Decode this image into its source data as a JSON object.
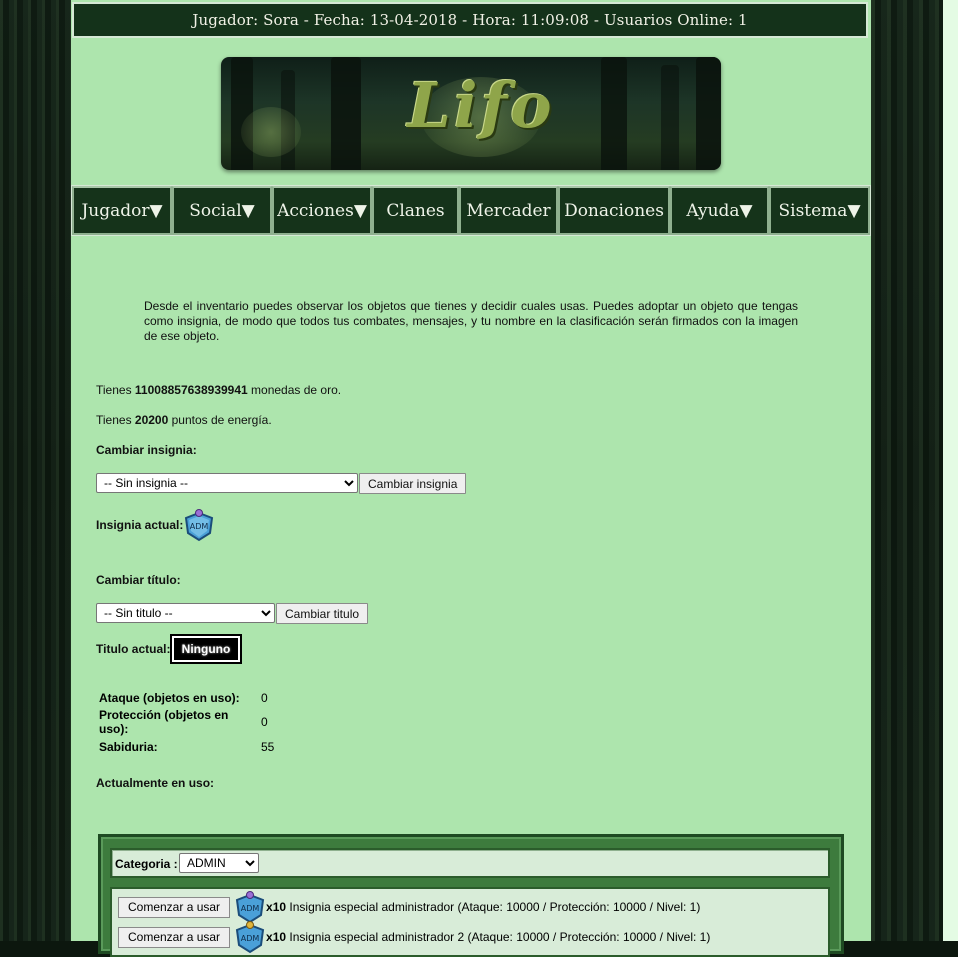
{
  "topbar": {
    "text": "Jugador: Sora - Fecha: 13-04-2018 - Hora: 11:09:08 - Usuarios Online: 1"
  },
  "banner": {
    "logo_text": "Lifo"
  },
  "nav": [
    {
      "label": "Jugador▼"
    },
    {
      "label": "Social▼"
    },
    {
      "label": "Acciones▼"
    },
    {
      "label": "Clanes"
    },
    {
      "label": "Mercader"
    },
    {
      "label": "Donaciones"
    },
    {
      "label": "Ayuda▼"
    },
    {
      "label": "Sistema▼"
    }
  ],
  "intro": "Desde el inventario puedes observar los objetos que tienes y decidir cuales usas. Puedes adoptar un objeto que tengas como insignia, de modo que todos tus combates, mensajes, y tu nombre en la clasificación serán firmados con la imagen de ese objeto.",
  "gold": {
    "prefix": "Tienes ",
    "amount": "11008857638939941",
    "suffix": " monedas de oro."
  },
  "energy": {
    "prefix": "Tienes ",
    "amount": "20200",
    "suffix": " puntos de energía."
  },
  "badge": {
    "change_label": "Cambiar insignia:",
    "select_value": "-- Sin insignia --",
    "button": "Cambiar insignia",
    "current_label": "Insignia actual:",
    "icon_text": "ADM"
  },
  "title": {
    "change_label": "Cambiar título:",
    "select_value": "-- Sin titulo --",
    "button": "Cambiar titulo",
    "current_label": "Titulo actual:",
    "current_value": "Ninguno"
  },
  "stats": [
    {
      "label": "Ataque (objetos en uso):",
      "value": "0"
    },
    {
      "label": "Protección (objetos en uso):",
      "value": "0"
    },
    {
      "label": "Sabiduria:",
      "value": "55"
    }
  ],
  "in_use_label": "Actualmente en uso:",
  "inventory": {
    "category_label": "Categoria :",
    "category_value": "ADMIN",
    "items": [
      {
        "button": "Comenzar a usar",
        "qty": "x10",
        "desc": "Insignia especial administrador (Ataque: 10000 / Protección: 10000 / Nivel: 1)",
        "gem_color": "#9b6fd6"
      },
      {
        "button": "Comenzar a usar",
        "qty": "x10",
        "desc": "Insignia especial administrador 2 (Ataque: 10000 / Protección: 10000 / Nivel: 1)",
        "gem_color": "#e0b53a"
      }
    ]
  }
}
